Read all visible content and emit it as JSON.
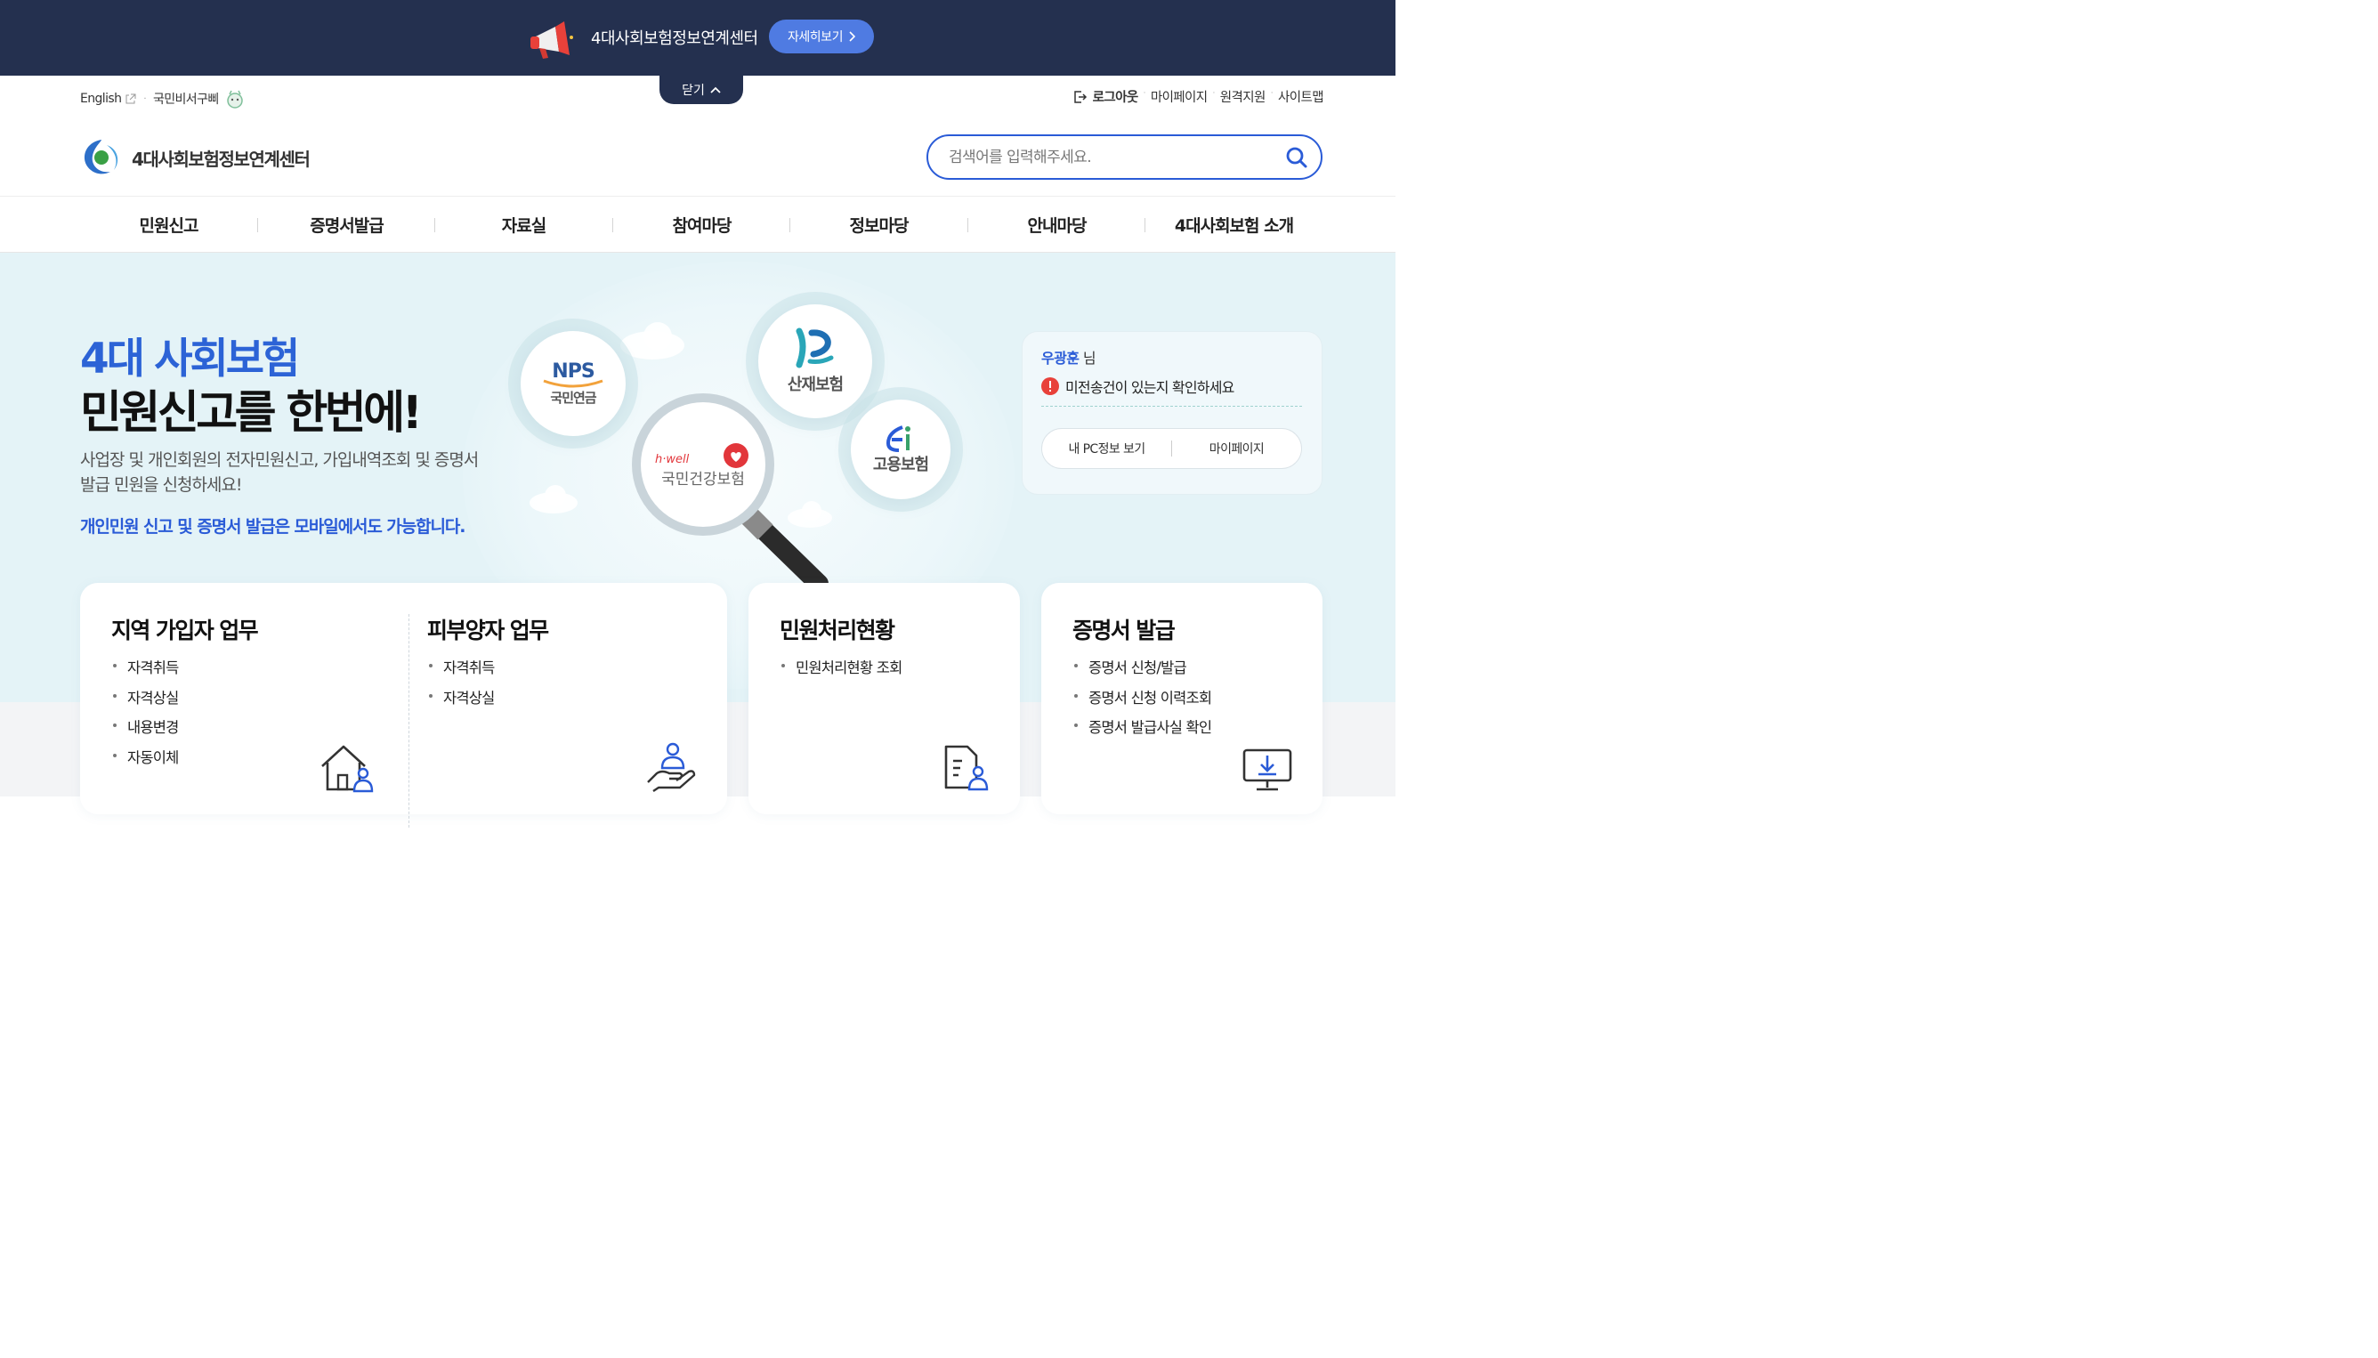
{
  "banner": {
    "title": "4대사회보험정보연계센터",
    "more_label": "자세히보기",
    "close_label": "닫기"
  },
  "util_left": {
    "english": "English",
    "assistant": "국민비서구삐"
  },
  "util_right": {
    "logout": "로그아웃",
    "mypage": "마이페이지",
    "remote": "원격지원",
    "sitemap": "사이트맵"
  },
  "logo": {
    "text": "4대사회보험정보연계센터"
  },
  "search": {
    "placeholder": "검색어를 입력해주세요."
  },
  "gnb": [
    "민원신고",
    "증명서발급",
    "자료실",
    "참여마당",
    "정보마당",
    "안내마당",
    "4대사회보험 소개"
  ],
  "hero": {
    "title1": "4대 사회보험",
    "title2": "민원신고를 한번에!",
    "desc": "사업장 및 개인회원의 전자민원신고, 가입내역조회 및 증명서 발급 민원을 신청하세요!",
    "mobile": "개인민원 신고 및 증명서 발급은 모바일에서도 가능합니다."
  },
  "bubbles": {
    "nps_logo": "NPS",
    "nps": "국민연금",
    "kcomwel": "산재보험",
    "employment": "고용보험",
    "nhis_logo": "h·well",
    "nhis": "국민건강보험"
  },
  "user": {
    "name": "우광훈",
    "suffix": "님",
    "notice": "미전송건이 있는지 확인하세요",
    "btn_pc": "내 PC정보 보기",
    "btn_mypage": "마이페이지"
  },
  "cards": {
    "region": {
      "title": "지역 가입자 업무",
      "items": [
        "자격취득",
        "자격상실",
        "내용변경",
        "자동이체"
      ]
    },
    "dependent": {
      "title": "피부양자 업무",
      "items": [
        "자격취득",
        "자격상실"
      ]
    },
    "status": {
      "title": "민원처리현황",
      "items": [
        "민원처리현황 조회"
      ]
    },
    "cert": {
      "title": "증명서 발급",
      "items": [
        "증명서 신청/발급",
        "증명서 신청 이력조회",
        "증명서 발급사실 확인"
      ]
    }
  },
  "colors": {
    "banner_bg": "#24304f",
    "accent_blue": "#2a5bd7",
    "hero_bg": "#e4f3f7",
    "notice_red": "#e8413a"
  }
}
